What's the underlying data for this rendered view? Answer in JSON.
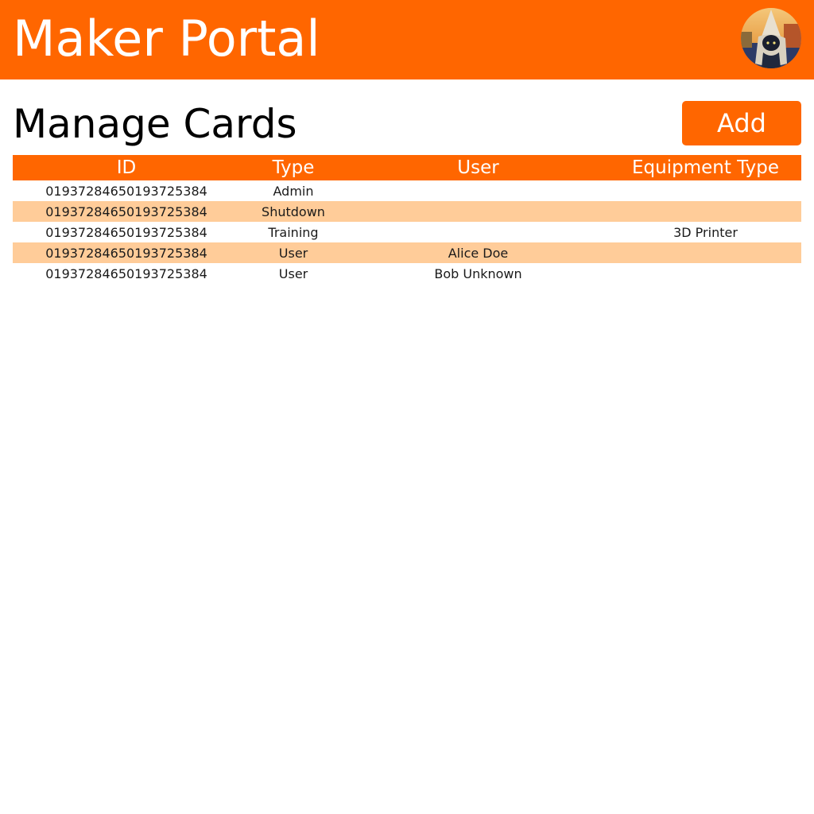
{
  "header": {
    "title": "Maker Portal",
    "avatar_icon": "user-avatar-photo"
  },
  "page": {
    "title": "Manage Cards",
    "add_label": "Add"
  },
  "table": {
    "columns": [
      "ID",
      "Type",
      "User",
      "Equipment Type"
    ],
    "rows": [
      {
        "id": "01937284650193725384",
        "type": "Admin",
        "user": "",
        "equipment_type": ""
      },
      {
        "id": "01937284650193725384",
        "type": "Shutdown",
        "user": "",
        "equipment_type": ""
      },
      {
        "id": "01937284650193725384",
        "type": "Training",
        "user": "",
        "equipment_type": "3D Printer"
      },
      {
        "id": "01937284650193725384",
        "type": "User",
        "user": "Alice Doe",
        "equipment_type": ""
      },
      {
        "id": "01937284650193725384",
        "type": "User",
        "user": "Bob Unknown",
        "equipment_type": ""
      }
    ]
  },
  "colors": {
    "accent": "#ff6600",
    "row_alt": "#ffcc99",
    "header_text": "#ffffff"
  }
}
